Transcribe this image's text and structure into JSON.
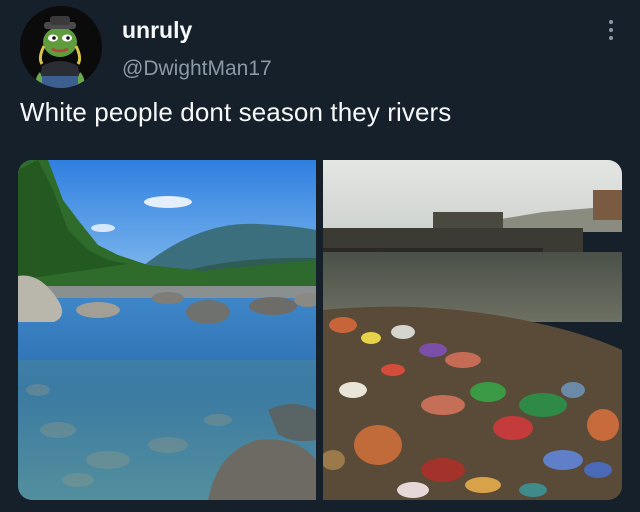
{
  "tweet": {
    "display_name": "unruly",
    "handle": "@DwightMan17",
    "text": "White people dont season they rivers",
    "more_icon": "more-vertical-icon",
    "avatar_icon": "pepe-frog-avatar"
  },
  "media": {
    "count": 2,
    "items": [
      {
        "name": "clean-river-photo",
        "subject": "clear mountain river with rocks and forest"
      },
      {
        "name": "polluted-river-photo",
        "subject": "riverbank covered in trash and garbage"
      }
    ]
  },
  "colors": {
    "background": "#15202b",
    "primary_text": "#f7f9f9",
    "secondary_text": "#8b98a5"
  }
}
